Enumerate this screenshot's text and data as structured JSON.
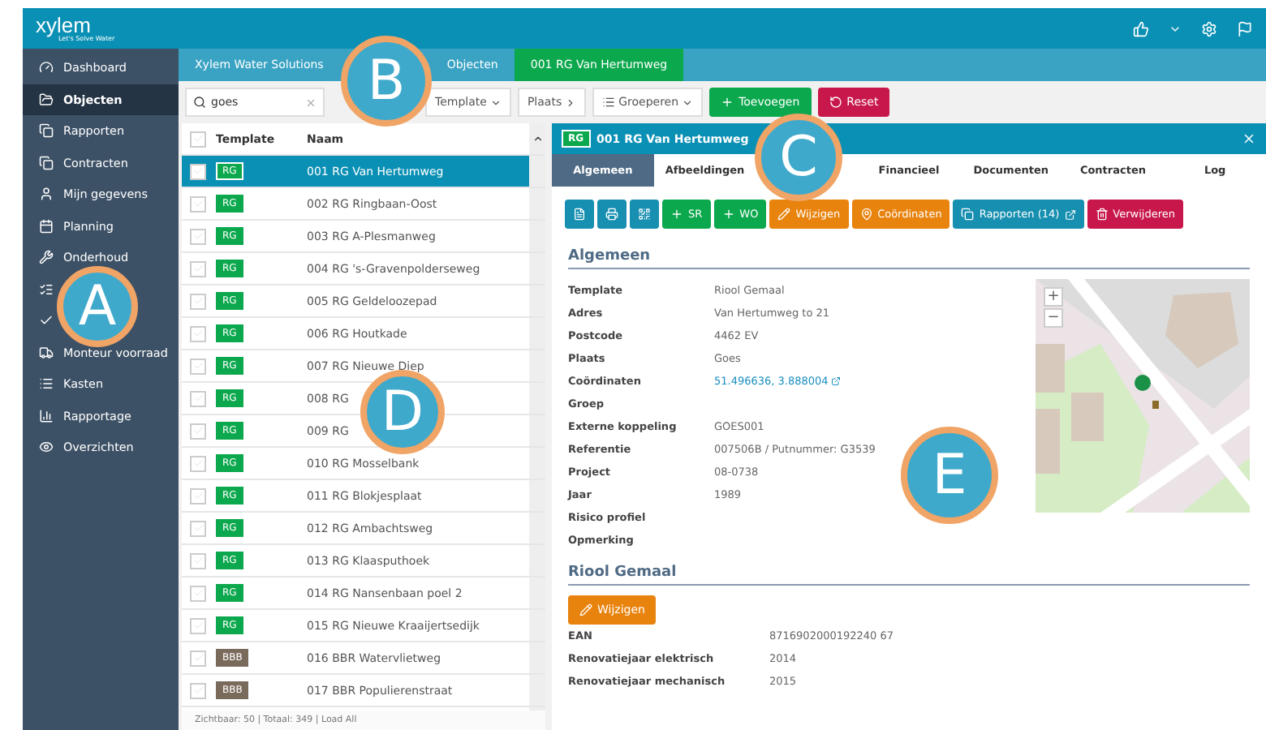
{
  "app": {
    "logo": "xylem",
    "tagline": "Let's Solve Water"
  },
  "sidebar": {
    "items": [
      {
        "label": "Dashboard",
        "selected": false
      },
      {
        "label": "Objecten",
        "selected": true
      },
      {
        "label": "Rapporten",
        "selected": false
      },
      {
        "label": "Contracten",
        "selected": false
      },
      {
        "label": "Mijn gegevens",
        "selected": false
      },
      {
        "label": "Planning",
        "selected": false
      },
      {
        "label": "Onderhoud",
        "selected": false
      },
      {
        "selected": false
      },
      {
        "selected": false
      },
      {
        "label": "Monteur voorraad",
        "selected": false
      },
      {
        "label": "Kasten",
        "selected": false
      },
      {
        "label": "Rapportage",
        "selected": false
      },
      {
        "label": "Overzichten",
        "selected": false
      }
    ]
  },
  "breadcrumb": [
    {
      "label": "Xylem Water Solutions",
      "current": false
    },
    {
      "label": "Objecten",
      "current": false
    },
    {
      "label": "001 RG Van Hertumweg",
      "current": true
    }
  ],
  "toolbar": {
    "search": "goes",
    "filters": [
      "Template",
      "Plaats"
    ],
    "group": "Groeperen",
    "add": "Toevoegen",
    "reset": "Reset"
  },
  "list": {
    "columns": [
      "Template",
      "Naam"
    ],
    "select_all": {
      "checked": false
    },
    "rows": [
      {
        "tag": "RG",
        "color": "#0ca84d",
        "name": "001 RG Van Hertumweg",
        "selected": true,
        "checked": false
      },
      {
        "tag": "RG",
        "color": "#0ca84d",
        "name": "002 RG Ringbaan-Oost",
        "selected": false,
        "checked": false
      },
      {
        "tag": "RG",
        "color": "#0ca84d",
        "name": "003 RG A-Plesmanweg",
        "selected": false,
        "checked": false
      },
      {
        "tag": "RG",
        "color": "#0ca84d",
        "name": "004 RG 's-Gravenpolderseweg",
        "selected": false,
        "checked": false
      },
      {
        "tag": "RG",
        "color": "#0ca84d",
        "name": "005 RG Geldeloozepad",
        "selected": false,
        "checked": false
      },
      {
        "tag": "RG",
        "color": "#0ca84d",
        "name": "006 RG Houtkade",
        "selected": false,
        "checked": false
      },
      {
        "tag": "RG",
        "color": "#0ca84d",
        "name": "007 RG Nieuwe Diep",
        "selected": false,
        "checked": false
      },
      {
        "tag": "RG",
        "color": "#0ca84d",
        "name": "008 RG",
        "selected": false,
        "checked": false
      },
      {
        "tag": "RG",
        "color": "#0ca84d",
        "name": "009 RG",
        "selected": false,
        "checked": false
      },
      {
        "tag": "RG",
        "color": "#0ca84d",
        "name": "010 RG Mosselbank",
        "selected": false,
        "checked": false
      },
      {
        "tag": "RG",
        "color": "#0ca84d",
        "name": "011 RG Blokjesplaat",
        "selected": false,
        "checked": false
      },
      {
        "tag": "RG",
        "color": "#0ca84d",
        "name": "012 RG Ambachtsweg",
        "selected": false,
        "checked": false
      },
      {
        "tag": "RG",
        "color": "#0ca84d",
        "name": "013 RG Klaasputhoek",
        "selected": false,
        "checked": false
      },
      {
        "tag": "RG",
        "color": "#0ca84d",
        "name": "014 RG Nansenbaan poel 2",
        "selected": false,
        "checked": false
      },
      {
        "tag": "RG",
        "color": "#0ca84d",
        "name": "015 RG Nieuwe Kraaijertsedijk",
        "selected": false,
        "checked": false
      },
      {
        "tag": "BBB",
        "color": "#7a6a5c",
        "name": "016 BBR Watervlietweg",
        "selected": false,
        "checked": false
      },
      {
        "tag": "BBB",
        "color": "#7a6a5c",
        "name": "017 BBR Populierenstraat",
        "selected": false,
        "checked": false
      }
    ],
    "footer": "Zichtbaar: 50 | Totaal: 349 | Load All"
  },
  "detail": {
    "tag": "RG",
    "title": "001 RG Van Hertumweg",
    "tabs": [
      {
        "label": "Algemeen",
        "selected": true
      },
      {
        "label": "Afbeeldingen",
        "selected": false
      },
      {
        "selected": false
      },
      {
        "label": "Financieel",
        "selected": false
      },
      {
        "label": "Documenten",
        "selected": false
      },
      {
        "label": "Contracten",
        "selected": false
      },
      {
        "label": "Log",
        "selected": false
      }
    ],
    "actions": [
      {
        "kind": "teal"
      },
      {
        "kind": "teal"
      },
      {
        "kind": "teal"
      },
      {
        "kind": "green",
        "label": "SR"
      },
      {
        "kind": "green",
        "label": "WO"
      },
      {
        "kind": "orange",
        "label": "Wijzigen"
      },
      {
        "kind": "orange",
        "label": "Coördinaten"
      },
      {
        "kind": "teal",
        "label": "Rapporten (14)"
      },
      {
        "kind": "red",
        "label": "Verwijderen"
      }
    ],
    "section": "Algemeen",
    "fields": [
      {
        "label": "Template",
        "value": "Riool Gemaal"
      },
      {
        "label": "Adres",
        "value": "Van Hertumweg to 21"
      },
      {
        "label": "Postcode",
        "value": "4462 EV"
      },
      {
        "label": "Plaats",
        "value": "Goes"
      },
      {
        "label": "Coördinaten",
        "value": "51.496636, 3.888004",
        "kind": "link"
      },
      {
        "label": "Groep"
      },
      {
        "label": "Externe koppeling",
        "value": "GOES001"
      },
      {
        "label": "Referentie",
        "value": "007506B / Putnummer: G3539"
      },
      {
        "label": "Project",
        "value": "08-0738"
      },
      {
        "label": "Jaar",
        "value": "1989"
      },
      {
        "label": "Risico profiel"
      },
      {
        "label": "Opmerking"
      }
    ],
    "map": {
      "zoom_in": "+",
      "zoom_out": "−"
    },
    "section2": "Riool Gemaal",
    "edit": "Wijzigen",
    "fields2": [
      {
        "label": "EAN",
        "value": "8716902000192240 67"
      },
      {
        "label": "Renovatiejaar elektrisch",
        "value": "2014"
      },
      {
        "label": "Renovatiejaar mechanisch",
        "value": "2015"
      }
    ]
  },
  "callouts": [
    "A",
    "B",
    "C",
    "D",
    "E"
  ]
}
